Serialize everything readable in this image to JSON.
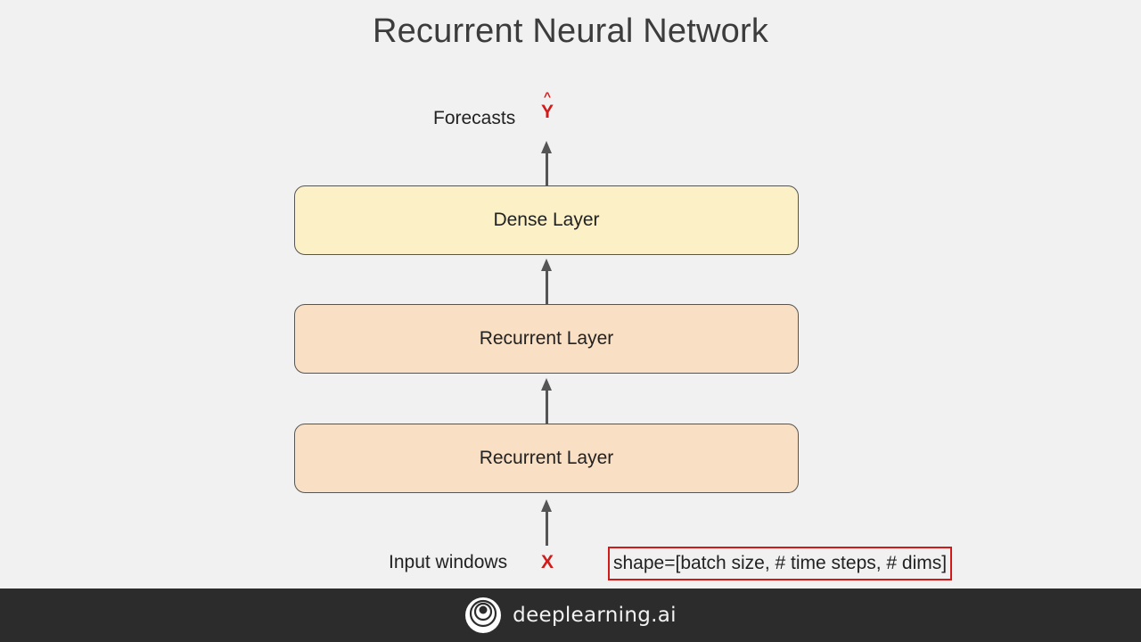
{
  "slide": {
    "title": "Recurrent Neural Network"
  },
  "diagram": {
    "output_label": "Forecasts",
    "output_hat": "^",
    "output_symbol": "Y",
    "layers": [
      {
        "name": "dense",
        "label": "Dense Layer",
        "color": "#fbf0c6"
      },
      {
        "name": "recurrent-1",
        "label": "Recurrent Layer",
        "color": "#f9dfc4"
      },
      {
        "name": "recurrent-2",
        "label": "Recurrent Layer",
        "color": "#f9dfc4"
      }
    ],
    "input_label": "Input windows",
    "input_symbol": "X",
    "shape_annotation": "shape=[batch size, # time steps, # dims]",
    "accent_color": "#d11a1a"
  },
  "footer": {
    "brand": "deeplearning.ai",
    "logo_icon": "deeplearning-logo-icon"
  }
}
